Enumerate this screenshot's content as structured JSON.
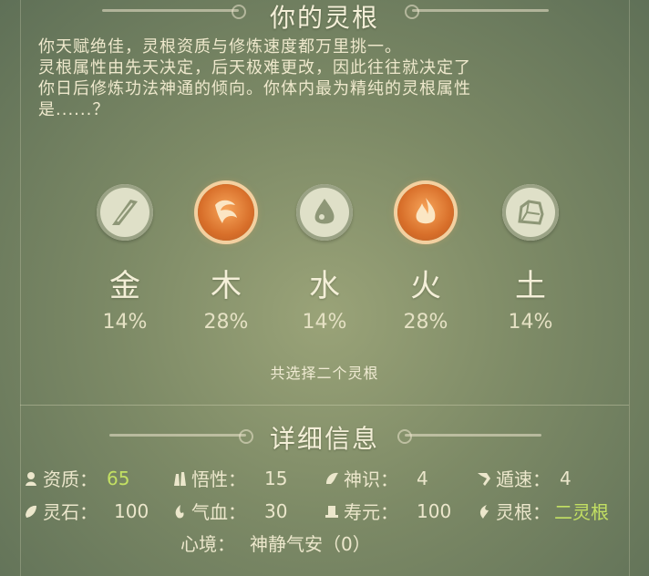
{
  "header": {
    "title": "你的灵根"
  },
  "intro": {
    "lines": [
      "你天赋绝佳，灵根资质与修炼速度都万里挑一。",
      "灵根属性由先天决定，后天极难更改，因此往往就决定了",
      "你日后修炼功法神通的倾向。你体内最为精纯的灵根属性",
      "是......？"
    ]
  },
  "roots": [
    {
      "label": "金",
      "percent": "14%",
      "icon": "metal-icon",
      "selected": false
    },
    {
      "label": "木",
      "percent": "28%",
      "icon": "wood-icon",
      "selected": true
    },
    {
      "label": "水",
      "percent": "14%",
      "icon": "water-icon",
      "selected": false
    },
    {
      "label": "火",
      "percent": "28%",
      "icon": "fire-icon",
      "selected": true
    },
    {
      "label": "土",
      "percent": "14%",
      "icon": "earth-icon",
      "selected": false
    }
  ],
  "choose_note": "共选择二个灵根",
  "details": {
    "title": "详细信息",
    "stats": {
      "aptitude": {
        "label": "资质：",
        "value": "65"
      },
      "comprehension": {
        "label": "悟性：",
        "value": "15"
      },
      "spirit_sense": {
        "label": "神识：",
        "value": "4"
      },
      "escape_speed": {
        "label": "遁速：",
        "value": "4"
      },
      "spirit_stones": {
        "label": "灵石：",
        "value": "100"
      },
      "qi_blood": {
        "label": "气血：",
        "value": "30"
      },
      "lifespan": {
        "label": "寿元：",
        "value": "100"
      },
      "spirit_root": {
        "label": "灵根：",
        "value": "二灵根"
      }
    },
    "mind_state": {
      "label": "心境：",
      "value": "神静气安（0）"
    }
  },
  "colors": {
    "highlight": "#c3e063",
    "active_orb": "#d86f2a",
    "inactive_orb": "#dfe0c8"
  }
}
